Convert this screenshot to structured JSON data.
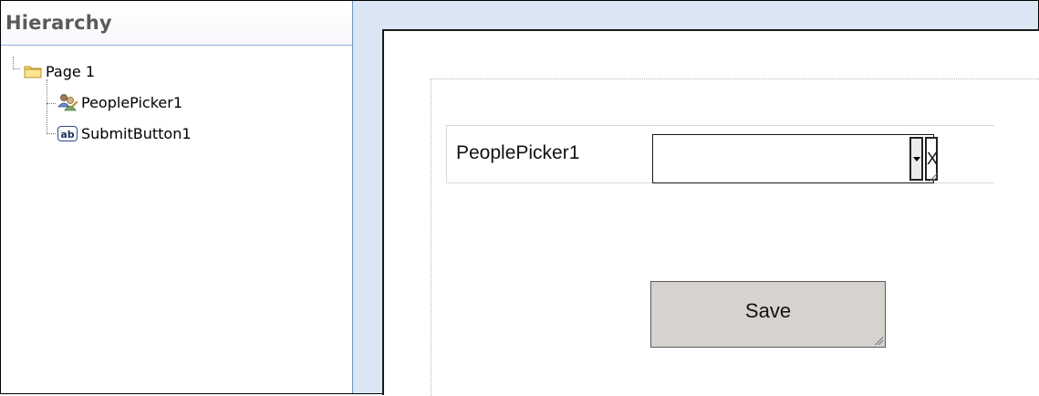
{
  "hierarchy": {
    "title": "Hierarchy",
    "items": [
      {
        "label": "Page 1",
        "icon": "folder-icon"
      },
      {
        "label": "PeoplePicker1",
        "icon": "people-picker-icon"
      },
      {
        "label": "SubmitButton1",
        "icon": "button-icon",
        "icon_text": "ab"
      }
    ]
  },
  "form": {
    "people_picker_label": "PeoplePicker1",
    "people_picker_value": "",
    "clear_glyph": "X",
    "save_label": "Save"
  },
  "colors": {
    "canvas_bg": "#dbe6f4",
    "button_bg": "#d6d3ce",
    "panel_border": "#6f97c4"
  }
}
